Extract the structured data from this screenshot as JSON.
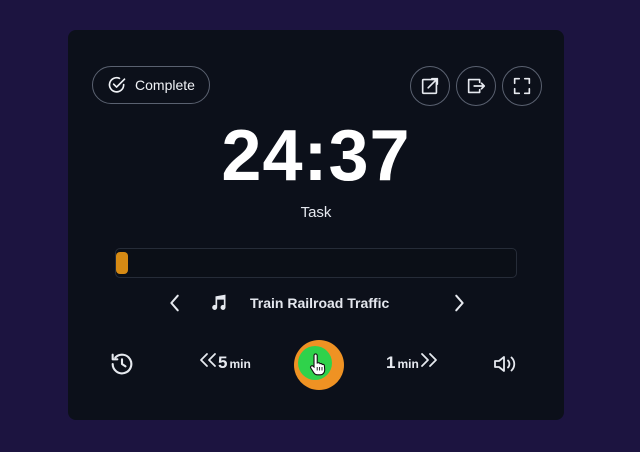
{
  "header": {
    "complete_label": "Complete",
    "icons": [
      "external-link-icon",
      "exit-icon",
      "fullscreen-icon"
    ]
  },
  "timer": {
    "time": "24:37",
    "label": "Task",
    "progress_fraction": 0.015
  },
  "sound": {
    "name": "Train Railroad Traffic",
    "icon": "music-note-icon"
  },
  "controls": {
    "skip_back": {
      "value": "5",
      "unit": "min"
    },
    "skip_forward": {
      "value": "1",
      "unit": "min"
    },
    "icons": [
      "history-icon",
      "play-pause-button",
      "volume-icon"
    ]
  },
  "colors": {
    "background": "#1c1440",
    "card": "#0c101a",
    "progress": "#d68a14",
    "play_outer": "#ef9223",
    "play_inner": "#2fd24b"
  }
}
